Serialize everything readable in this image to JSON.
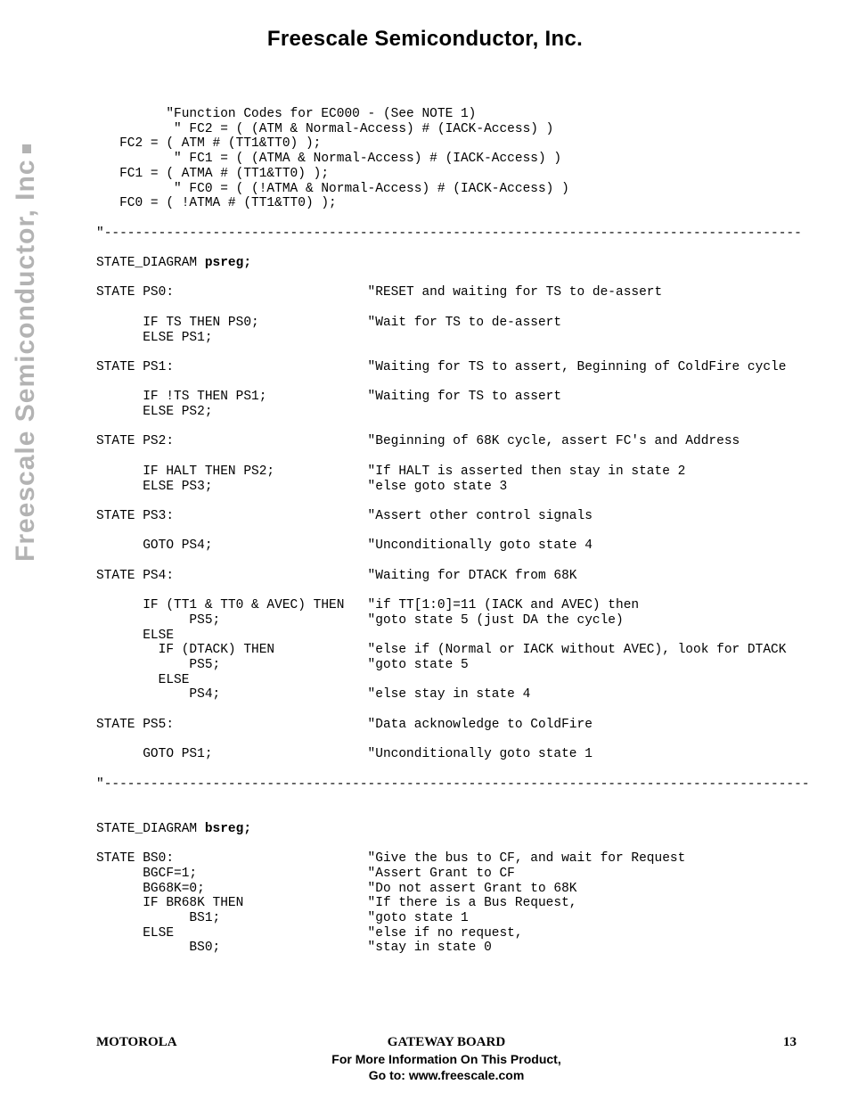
{
  "header": {
    "title": "Freescale Semiconductor, Inc."
  },
  "watermark": {
    "text": "Freescale Semiconductor, Inc"
  },
  "code": {
    "lines": [
      {
        "t": "         \"Function Codes for EC000 - (See NOTE 1)"
      },
      {
        "t": "          \" FC2 = ( (ATM & Normal-Access) # (IACK-Access) )"
      },
      {
        "t": "   FC2 = ( ATM # (TT1&TT0) );"
      },
      {
        "t": "          \" FC1 = ( (ATMA & Normal-Access) # (IACK-Access) )"
      },
      {
        "t": "   FC1 = ( ATMA # (TT1&TT0) );"
      },
      {
        "t": "          \" FC0 = ( (!ATMA & Normal-Access) # (IACK-Access) )"
      },
      {
        "t": "   FC0 = ( !ATMA # (TT1&TT0) );"
      },
      {
        "t": ""
      },
      {
        "t": "\"------------------------------------------------------------------------------------------"
      },
      {
        "t": ""
      },
      {
        "segments": [
          {
            "t": "STATE_DIAGRAM "
          },
          {
            "t": "psreg;",
            "b": true
          }
        ]
      },
      {
        "t": ""
      },
      {
        "t": "STATE PS0:                         \"RESET and waiting for TS to de-assert"
      },
      {
        "t": ""
      },
      {
        "t": "      IF TS THEN PS0;              \"Wait for TS to de-assert"
      },
      {
        "t": "      ELSE PS1;"
      },
      {
        "t": ""
      },
      {
        "t": "STATE PS1:                         \"Waiting for TS to assert, Beginning of ColdFire cycle"
      },
      {
        "t": ""
      },
      {
        "t": "      IF !TS THEN PS1;             \"Waiting for TS to assert"
      },
      {
        "t": "      ELSE PS2;"
      },
      {
        "t": ""
      },
      {
        "t": "STATE PS2:                         \"Beginning of 68K cycle, assert FC's and Address"
      },
      {
        "t": ""
      },
      {
        "t": "      IF HALT THEN PS2;            \"If HALT is asserted then stay in state 2"
      },
      {
        "t": "      ELSE PS3;                    \"else goto state 3"
      },
      {
        "t": ""
      },
      {
        "t": "STATE PS3:                         \"Assert other control signals"
      },
      {
        "t": ""
      },
      {
        "t": "      GOTO PS4;                    \"Unconditionally goto state 4"
      },
      {
        "t": ""
      },
      {
        "t": "STATE PS4:                         \"Waiting for DTACK from 68K"
      },
      {
        "t": ""
      },
      {
        "t": "      IF (TT1 & TT0 & AVEC) THEN   \"if TT[1:0]=11 (IACK and AVEC) then"
      },
      {
        "t": "            PS5;                   \"goto state 5 (just DA the cycle)"
      },
      {
        "t": "      ELSE"
      },
      {
        "t": "        IF (DTACK) THEN            \"else if (Normal or IACK without AVEC), look for DTACK"
      },
      {
        "t": "            PS5;                   \"goto state 5"
      },
      {
        "t": "        ELSE"
      },
      {
        "t": "            PS4;                   \"else stay in state 4"
      },
      {
        "t": ""
      },
      {
        "t": "STATE PS5:                         \"Data acknowledge to ColdFire"
      },
      {
        "t": ""
      },
      {
        "t": "      GOTO PS1;                    \"Unconditionally goto state 1"
      },
      {
        "t": ""
      },
      {
        "t": "\"-------------------------------------------------------------------------------------------"
      },
      {
        "t": ""
      },
      {
        "t": ""
      },
      {
        "segments": [
          {
            "t": "STATE_DIAGRAM "
          },
          {
            "t": "bsreg;",
            "b": true
          }
        ]
      },
      {
        "t": ""
      },
      {
        "t": "STATE BS0:                         \"Give the bus to CF, and wait for Request"
      },
      {
        "t": "      BGCF=1;                      \"Assert Grant to CF"
      },
      {
        "t": "      BG68K=0;                     \"Do not assert Grant to 68K"
      },
      {
        "t": "      IF BR68K THEN                \"If there is a Bus Request,"
      },
      {
        "t": "            BS1;                   \"goto state 1"
      },
      {
        "t": "      ELSE                         \"else if no request,"
      },
      {
        "t": "            BS0;                   \"stay in state 0"
      }
    ]
  },
  "footer": {
    "left": "MOTOROLA",
    "center": "GATEWAY BOARD",
    "right": "13",
    "info1": "For More Information On This Product,",
    "info2": "Go to: www.freescale.com"
  }
}
